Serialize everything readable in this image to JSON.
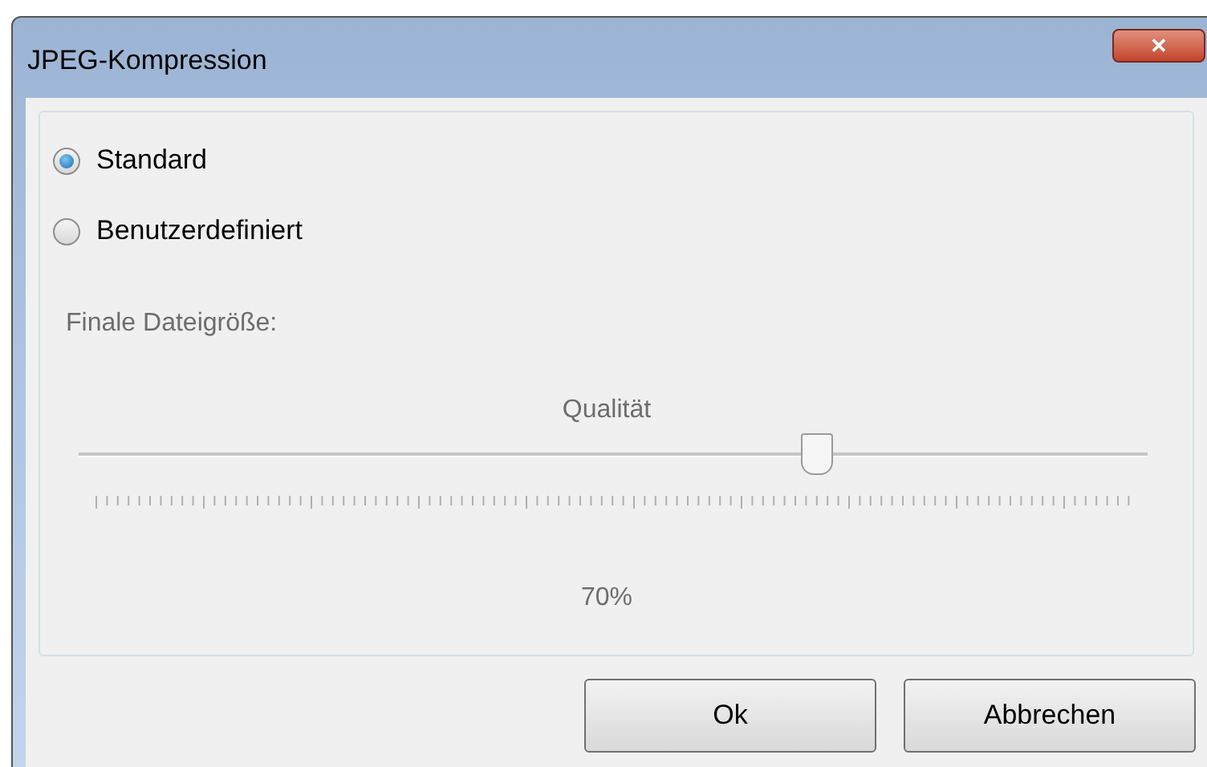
{
  "window": {
    "title": "JPEG-Kompression",
    "close": "✕"
  },
  "options": [
    {
      "label": "Standard",
      "selected": true
    },
    {
      "label": "Benutzerdefiniert",
      "selected": false
    }
  ],
  "custom": {
    "disabled": true,
    "size_label": "Finale Dateigröße:",
    "slider": {
      "label": "Qualität",
      "level": 0.69,
      "reading": "70%"
    }
  },
  "buttons": [
    "Ok",
    "Abbrechen"
  ]
}
